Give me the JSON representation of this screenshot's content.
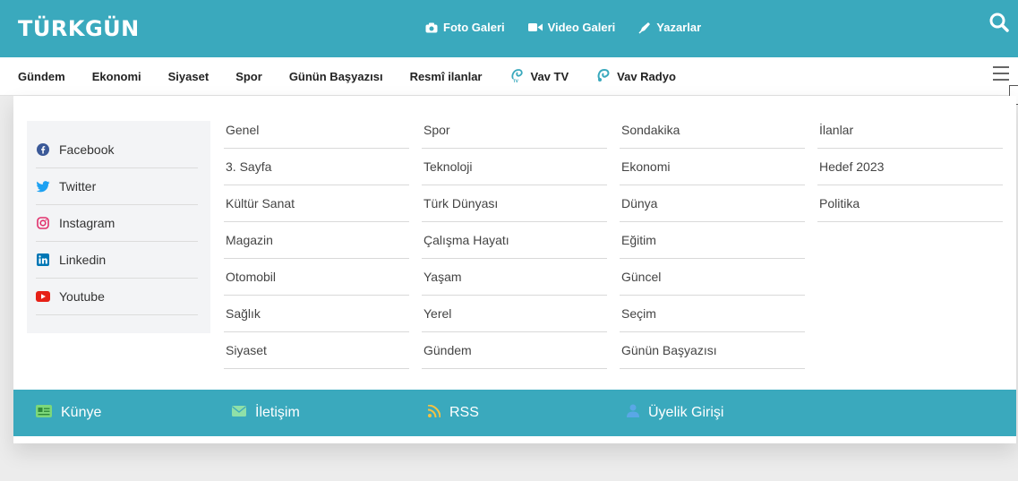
{
  "brand": {
    "logo": "TÜRKGÜN"
  },
  "topnav": [
    {
      "label": "Foto Galeri",
      "icon": "camera-icon"
    },
    {
      "label": "Video Galeri",
      "icon": "video-icon"
    },
    {
      "label": "Yazarlar",
      "icon": "pen-icon"
    }
  ],
  "categories": [
    {
      "label": "Gündem"
    },
    {
      "label": "Ekonomi"
    },
    {
      "label": "Siyaset"
    },
    {
      "label": "Spor"
    },
    {
      "label": "Günün Başyazısı"
    },
    {
      "label": "Resmî ilanlar"
    },
    {
      "label": "Vav TV",
      "icon": "vav-tv-icon"
    },
    {
      "label": "Vav Radyo",
      "icon": "vav-radyo-icon"
    }
  ],
  "social": [
    {
      "label": "Facebook",
      "icon": "facebook-icon",
      "color": "#3b5998"
    },
    {
      "label": "Twitter",
      "icon": "twitter-icon",
      "color": "#1da1f2"
    },
    {
      "label": "Instagram",
      "icon": "instagram-icon",
      "color": "#e1306c"
    },
    {
      "label": "Linkedin",
      "icon": "linkedin-icon",
      "color": "#0077b5"
    },
    {
      "label": "Youtube",
      "icon": "youtube-icon",
      "color": "#e62117"
    }
  ],
  "menu_columns": [
    [
      "Genel",
      "3. Sayfa",
      "Kültür Sanat",
      "Magazin",
      "Otomobil",
      "Sağlık",
      "Siyaset"
    ],
    [
      "Spor",
      "Teknoloji",
      "Türk Dünyası",
      "Çalışma Hayatı",
      "Yaşam",
      "Yerel",
      "Gündem"
    ],
    [
      "Sondakika",
      "Ekonomi",
      "Dünya",
      "Eğitim",
      "Güncel",
      "Seçim",
      "Günün Başyazısı"
    ],
    [
      "İlanlar",
      "Hedef 2023",
      "Politika"
    ]
  ],
  "footer": [
    {
      "label": "Künye",
      "icon": "id-card-icon",
      "color": "#7dd87a"
    },
    {
      "label": "İletişim",
      "icon": "envelope-icon",
      "color": "#8fe0a8"
    },
    {
      "label": "RSS",
      "icon": "rss-icon",
      "color": "#f5c242"
    },
    {
      "label": "Üyelik Girişi",
      "icon": "user-icon",
      "color": "#5aa7e6"
    }
  ],
  "colors": {
    "accent": "#3aa9bd"
  }
}
